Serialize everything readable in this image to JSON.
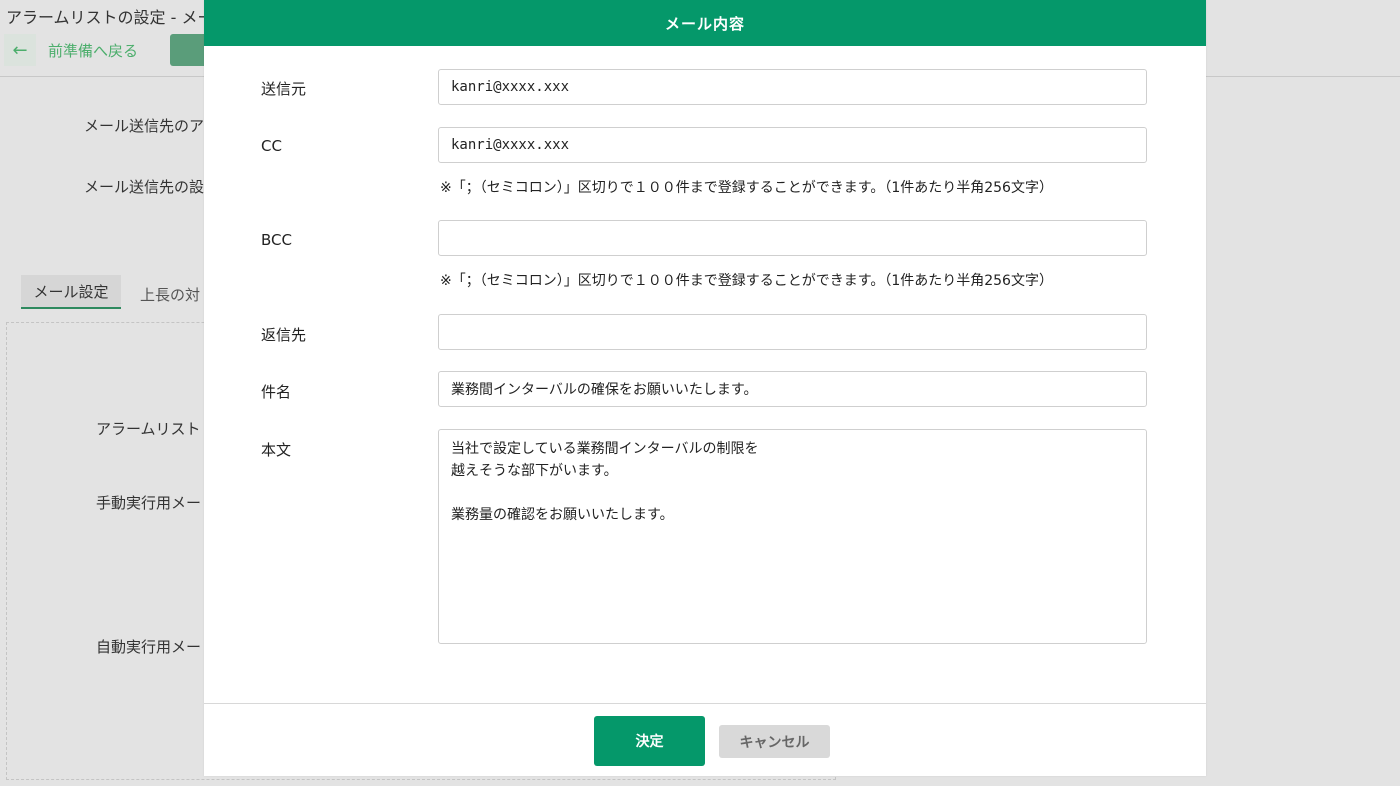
{
  "background": {
    "window_title": "アラームリストの設定 - メー",
    "back_label": "前準備へ戻る",
    "labels": {
      "recipient_address": "メール送信先のア",
      "recipient_settings": "メール送信先の設",
      "alarm_list": "アラームリスト",
      "manual_mail": "手動実行用メー",
      "auto_mail": "自動実行用メー"
    },
    "tabs": {
      "active": "メール設定",
      "other": "上長の対"
    }
  },
  "modal": {
    "title": "メール内容",
    "fields": {
      "from_label": "送信元",
      "from_value": "kanri@xxxx.xxx",
      "cc_label": "CC",
      "cc_value": "kanri@xxxx.xxx",
      "cc_note": "※「；（セミコロン）」区切りで１００件まで登録することができます。（1件あたり半角256文字）",
      "bcc_label": "BCC",
      "bcc_value": "",
      "bcc_note": "※「；（セミコロン）」区切りで１００件まで登録することができます。（1件あたり半角256文字）",
      "reply_label": "返信先",
      "reply_value": "",
      "subject_label": "件名",
      "subject_value": "業務間インターバルの確保をお願いいたします。",
      "body_label": "本文",
      "body_value": "当社で設定している業務間インターバルの制限を\n越えそうな部下がいます。\n\n業務量の確認をお願いいたします。"
    },
    "buttons": {
      "ok": "決定",
      "cancel": "キャンセル"
    }
  },
  "colors": {
    "accent": "#05986a",
    "back_link": "#4cae6c",
    "overlay": "#e3e3e3"
  }
}
